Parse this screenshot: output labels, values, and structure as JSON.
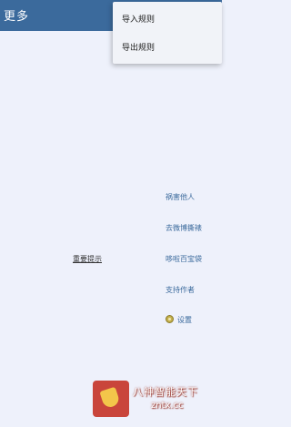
{
  "header": {
    "title": "更多"
  },
  "menu": {
    "items": [
      {
        "label": "导入规则"
      },
      {
        "label": "导出规则"
      }
    ]
  },
  "notice": {
    "label": "重要提示"
  },
  "links": [
    {
      "label": "祸害他人"
    },
    {
      "label": "去微博撕裱"
    },
    {
      "label": "哆啦百宝袋"
    },
    {
      "label": "支持作者"
    }
  ],
  "settings": {
    "label": "设置",
    "icon": "gear-icon"
  },
  "watermark": {
    "name": "八神智能天下",
    "domain": "zntx.cc"
  },
  "colors": {
    "header_bg": "#3b6a9c",
    "page_bg": "#eef1fb",
    "link": "#3b6a9c"
  }
}
